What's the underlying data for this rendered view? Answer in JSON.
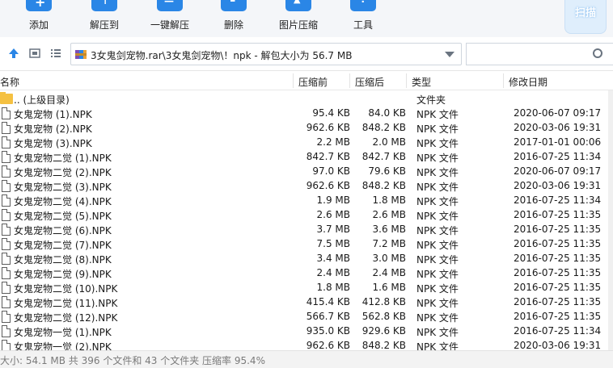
{
  "toolbar": {
    "add": "添加",
    "extract_to": "解压到",
    "one_click_extract": "一键解压",
    "delete": "删除",
    "image_compress": "图片压缩",
    "tools": "工具",
    "scan": "扫描"
  },
  "address": {
    "path_text": "3女鬼剑宠物.rar\\3女鬼剑宠物\\！npk - 解包大小为 56.7 MB",
    "search_placeholder": ""
  },
  "columns": {
    "name": "名称",
    "compressed": "压缩前",
    "packed": "压缩后",
    "type": "类型",
    "modified": "修改日期"
  },
  "parent_row": {
    "name": ".. (上级目录)",
    "type": "文件夹"
  },
  "files": [
    {
      "name": "女鬼宠物 (1).NPK",
      "orig": "95.4 KB",
      "packed": "84.0 KB",
      "type": "NPK 文件",
      "date": "2020-06-07 09:17"
    },
    {
      "name": "女鬼宠物 (2).NPK",
      "orig": "962.6 KB",
      "packed": "848.2 KB",
      "type": "NPK 文件",
      "date": "2020-03-06 19:31"
    },
    {
      "name": "女鬼宠物 (3).NPK",
      "orig": "2.2 MB",
      "packed": "2.0 MB",
      "type": "NPK 文件",
      "date": "2017-01-01 00:06"
    },
    {
      "name": "女鬼宠物二觉 (1).NPK",
      "orig": "842.7 KB",
      "packed": "842.7 KB",
      "type": "NPK 文件",
      "date": "2016-07-25 11:34"
    },
    {
      "name": "女鬼宠物二觉 (2).NPK",
      "orig": "97.0 KB",
      "packed": "79.6 KB",
      "type": "NPK 文件",
      "date": "2020-06-07 09:17"
    },
    {
      "name": "女鬼宠物二觉 (3).NPK",
      "orig": "962.6 KB",
      "packed": "848.2 KB",
      "type": "NPK 文件",
      "date": "2020-03-06 19:31"
    },
    {
      "name": "女鬼宠物二觉 (4).NPK",
      "orig": "1.9 MB",
      "packed": "1.8 MB",
      "type": "NPK 文件",
      "date": "2016-07-25 11:34"
    },
    {
      "name": "女鬼宠物二觉 (5).NPK",
      "orig": "2.6 MB",
      "packed": "2.6 MB",
      "type": "NPK 文件",
      "date": "2016-07-25 11:35"
    },
    {
      "name": "女鬼宠物二觉 (6).NPK",
      "orig": "3.7 MB",
      "packed": "3.6 MB",
      "type": "NPK 文件",
      "date": "2016-07-25 11:35"
    },
    {
      "name": "女鬼宠物二觉 (7).NPK",
      "orig": "7.5 MB",
      "packed": "7.2 MB",
      "type": "NPK 文件",
      "date": "2016-07-25 11:35"
    },
    {
      "name": "女鬼宠物二觉 (8).NPK",
      "orig": "3.4 MB",
      "packed": "3.0 MB",
      "type": "NPK 文件",
      "date": "2016-07-25 11:35"
    },
    {
      "name": "女鬼宠物二觉 (9).NPK",
      "orig": "2.4 MB",
      "packed": "2.4 MB",
      "type": "NPK 文件",
      "date": "2016-07-25 11:35"
    },
    {
      "name": "女鬼宠物二觉 (10).NPK",
      "orig": "1.8 MB",
      "packed": "1.6 MB",
      "type": "NPK 文件",
      "date": "2016-07-25 11:35"
    },
    {
      "name": "女鬼宠物二觉 (11).NPK",
      "orig": "415.4 KB",
      "packed": "412.8 KB",
      "type": "NPK 文件",
      "date": "2016-07-25 11:35"
    },
    {
      "name": "女鬼宠物二觉 (12).NPK",
      "orig": "566.7 KB",
      "packed": "562.8 KB",
      "type": "NPK 文件",
      "date": "2016-07-25 11:35"
    },
    {
      "name": "女鬼宠物一觉 (1).NPK",
      "orig": "935.0 KB",
      "packed": "929.6 KB",
      "type": "NPK 文件",
      "date": "2016-07-25 11:34"
    },
    {
      "name": "女鬼宠物一觉 (2).NPK",
      "orig": "962.6 KB",
      "packed": "848.2 KB",
      "type": "NPK 文件",
      "date": "2020-03-06 19:31"
    }
  ],
  "status": "大小: 54.1 MB 共 396 个文件和 43 个文件夹 压缩率 95.4%",
  "colors": {
    "accent": "#2a86e6",
    "folder": "#f5c142"
  }
}
